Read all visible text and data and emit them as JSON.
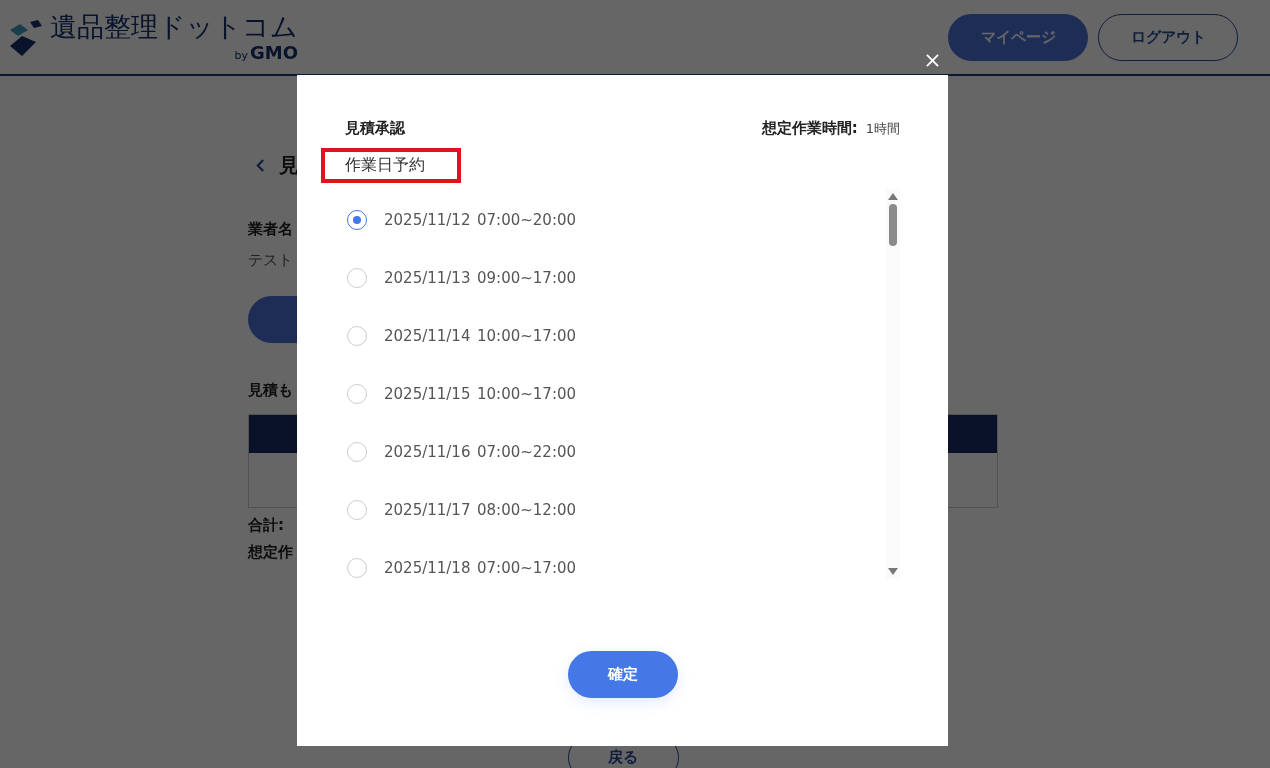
{
  "header": {
    "logo_text": "遺品整理ドットコム",
    "logo_by": "by",
    "logo_brand": "GMO",
    "buttons": [
      {
        "label": "マイページ",
        "kind": "primary"
      },
      {
        "label": "ログアウト",
        "kind": "outline"
      }
    ]
  },
  "page": {
    "heading": "見",
    "vendor_label": "業者名",
    "vendor_value": "テスト",
    "estimate_label": "見積も",
    "total_label": "合計:",
    "duration_label": "想定作",
    "back_button": "戻る"
  },
  "modal": {
    "title": "見積承認",
    "duration_label": "想定作業時間:",
    "duration_value": "1時間",
    "section_label": "作業日予約",
    "slots": [
      {
        "date": "2025/11/12",
        "time": "07:00~20:00",
        "selected": true
      },
      {
        "date": "2025/11/13",
        "time": "09:00~17:00",
        "selected": false
      },
      {
        "date": "2025/11/14",
        "time": "10:00~17:00",
        "selected": false
      },
      {
        "date": "2025/11/15",
        "time": "10:00~17:00",
        "selected": false
      },
      {
        "date": "2025/11/16",
        "time": "07:00~22:00",
        "selected": false
      },
      {
        "date": "2025/11/17",
        "time": "08:00~12:00",
        "selected": false
      },
      {
        "date": "2025/11/18",
        "time": "07:00~17:00",
        "selected": false
      }
    ],
    "confirm_button": "確定"
  }
}
